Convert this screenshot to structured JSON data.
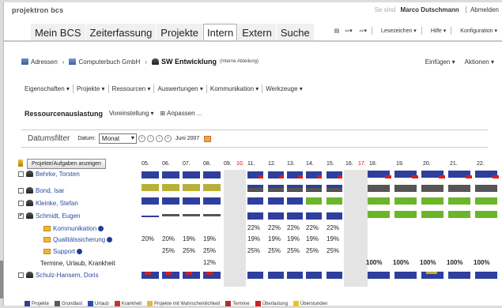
{
  "header": {
    "brand": "projektron bcs",
    "user_prefix": "Se sind",
    "user_name": "Marco Dutschmann",
    "logout": "Abmelden"
  },
  "nav_tabs": [
    {
      "label": "Mein BCS",
      "active": false
    },
    {
      "label": "Zeiterfassung",
      "active": false
    },
    {
      "label": "Projekte",
      "active": false
    },
    {
      "label": "Intern",
      "active": true
    },
    {
      "label": "Extern",
      "active": false
    },
    {
      "label": "Suche",
      "active": false
    }
  ],
  "nav_tools": {
    "lesezeichen": "Lesezeichen ▾",
    "hilfe": "Hilfe ▾",
    "konfiguration": "Konfiguration ▾"
  },
  "breadcrumb": {
    "items": [
      "Adressen",
      "Computerbuch GmbH",
      "SW Entwicklung"
    ],
    "note": "(Interne Abteilung)",
    "actions": [
      "Einfügen ▾",
      "Aktionen ▾"
    ]
  },
  "toolbar": [
    "Eigenschaften ▾",
    "Projekte ▾",
    "Ressourcen ▾",
    "Auswertungen ▾",
    "Kommunikation ▾",
    "Werkzeuge ▾"
  ],
  "section": {
    "title": "Ressourcenauslastung",
    "preset": "Voreinstellung ▾",
    "adjust": "⊞ Anpassen ..."
  },
  "datefilter": {
    "label": "Datumsfilter",
    "date_label": "Datum:",
    "period": "Monat",
    "month": "Juni 2007"
  },
  "grid": {
    "show_button": "Projekte/Aufgaben anzeigen",
    "days": [
      {
        "d": "05.",
        "red": false
      },
      {
        "d": "06.",
        "red": false
      },
      {
        "d": "07.",
        "red": false
      },
      {
        "d": "08.",
        "red": false
      },
      {
        "d": "09.",
        "red": false
      },
      {
        "d": "10.",
        "red": true
      },
      {
        "d": "11.",
        "red": false
      },
      {
        "d": "12.",
        "red": false
      },
      {
        "d": "13.",
        "red": false
      },
      {
        "d": "14.",
        "red": false
      },
      {
        "d": "15.",
        "red": false
      },
      {
        "d": "16.",
        "red": false
      },
      {
        "d": "17.",
        "red": true
      },
      {
        "d": "18.",
        "red": false
      },
      {
        "d": "19.",
        "red": false
      },
      {
        "d": "20.",
        "red": false
      },
      {
        "d": "21.",
        "red": false
      },
      {
        "d": "22.",
        "red": false
      }
    ],
    "people": [
      {
        "name": "Behrke, Torsten",
        "checked": false
      },
      {
        "name": "Bond, Isar",
        "checked": false
      },
      {
        "name": "Kleinke, Stefan",
        "checked": false
      },
      {
        "name": "Schmidt, Eugen",
        "checked": true
      }
    ],
    "sub_items": [
      {
        "name": "Kommunikation",
        "values": [
          "",
          "",
          "",
          "",
          "22%",
          "22%",
          "22%",
          "22%",
          "22%"
        ]
      },
      {
        "name": "Qualitätssicherung",
        "values": [
          "20%",
          "20%",
          "19%",
          "19%",
          "19%",
          "19%",
          "19%",
          "19%",
          "19%"
        ]
      },
      {
        "name": "Support",
        "values": [
          "",
          "25%",
          "25%",
          "25%",
          "25%",
          "25%",
          "25%",
          "25%",
          "25%"
        ]
      }
    ],
    "termine_row": {
      "label": "Termine, Urlaub, Krankheit",
      "week1": [
        "",
        "",
        "",
        "12%"
      ],
      "week3": [
        "100%",
        "100%",
        "100%",
        "100%",
        "100%"
      ]
    },
    "last_person": {
      "name": "Schulz-Hansem, Doris",
      "checked": false
    }
  },
  "legend": [
    {
      "label": "Projekte",
      "color": "#2e3f9e"
    },
    {
      "label": "Grundlast",
      "color": "#5a5a5a"
    },
    {
      "label": "Urlaub",
      "color": "#2a4fb0"
    },
    {
      "label": "Krankheit",
      "color": "#c0392b"
    },
    {
      "label": "Projekte mit Wahrscheinlichkeit",
      "color": "#e8b64a"
    },
    {
      "label": "Termine",
      "color": "#b03030"
    },
    {
      "label": "Überlastung",
      "color": "#d02020"
    },
    {
      "label": "Überstunden",
      "color": "#f0c020"
    }
  ],
  "colors": {
    "projects": "#2e3f9e",
    "green": "#6ab52a",
    "olive": "#b8b03a",
    "grey": "#555555",
    "red": "#d02020",
    "weekend": "#e4e4e4"
  }
}
